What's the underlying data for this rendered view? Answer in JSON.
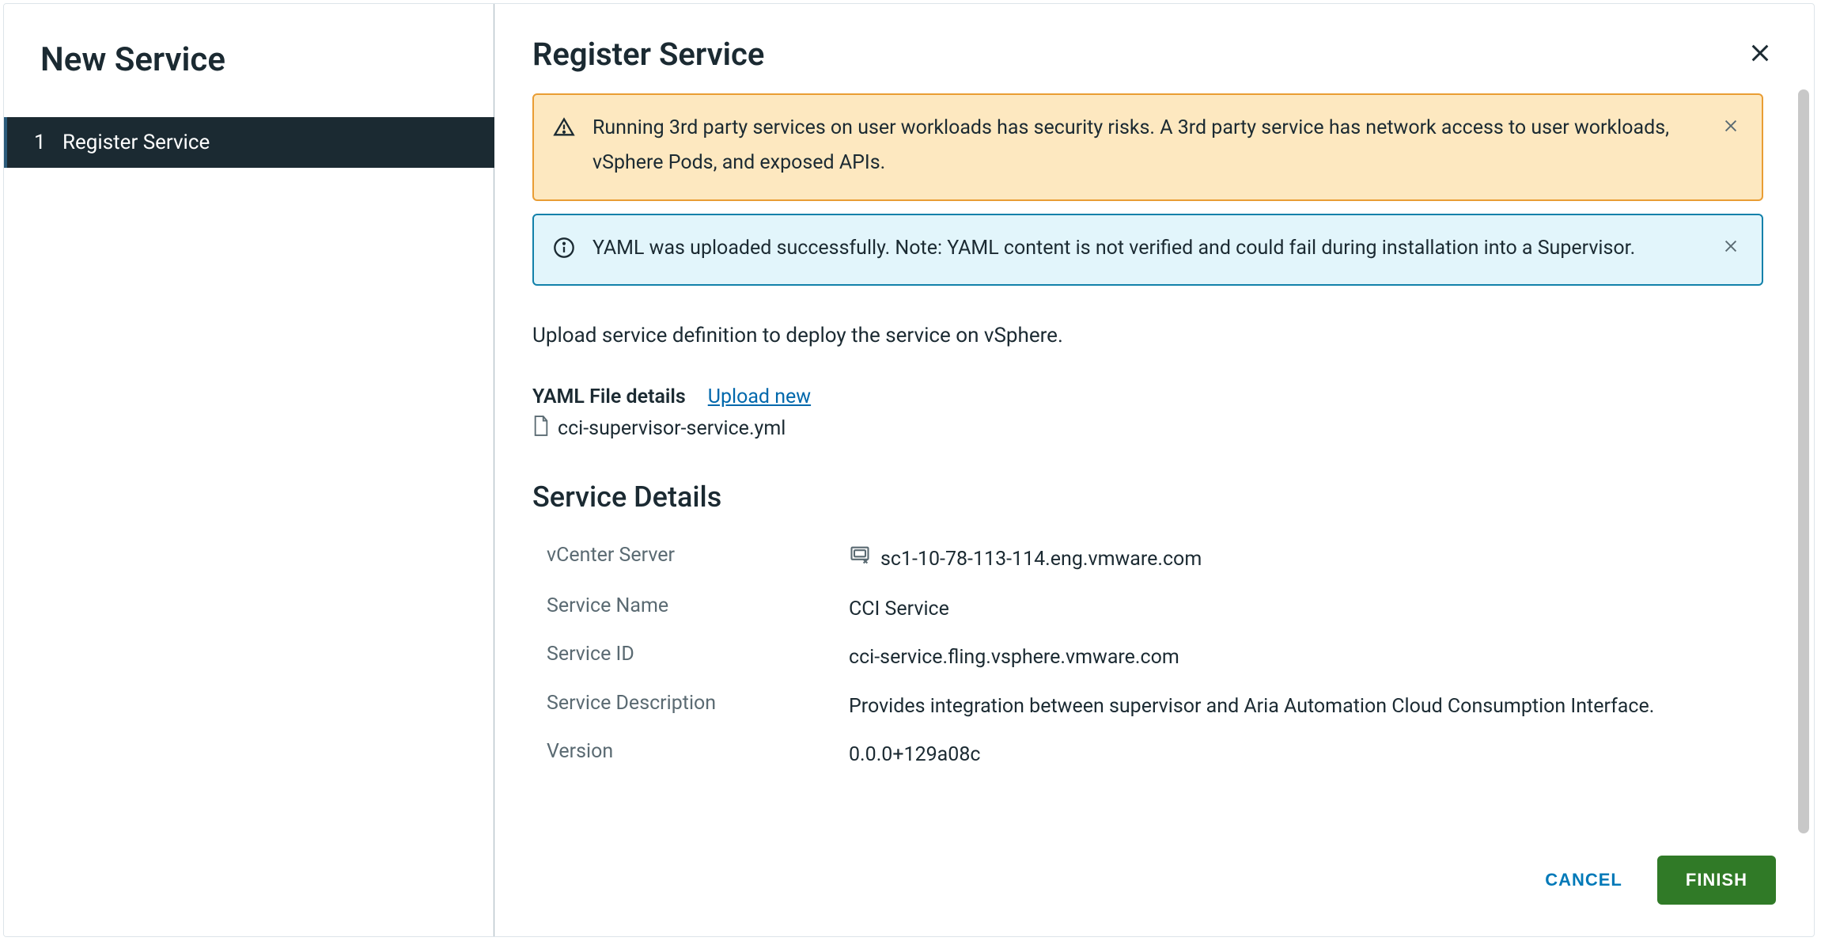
{
  "left": {
    "title": "New Service",
    "steps": [
      {
        "num": "1",
        "label": "Register Service"
      }
    ]
  },
  "right": {
    "title": "Register Service",
    "alerts": {
      "warning": "Running 3rd party services on user workloads has security risks. A 3rd party service has network access to user workloads, vSphere Pods, and exposed APIs.",
      "info": "YAML was uploaded successfully. Note: YAML content is not verified and could fail during installation into a Supervisor."
    },
    "upload_desc": "Upload service definition to deploy the service on vSphere.",
    "yaml_label": "YAML File details",
    "upload_new": "Upload new",
    "file_name": "cci-supervisor-service.yml",
    "section_heading": "Service Details",
    "details": {
      "vcenter_label": "vCenter Server",
      "vcenter_value": "sc1-10-78-113-114.eng.vmware.com",
      "name_label": "Service Name",
      "name_value": "CCI Service",
      "id_label": "Service ID",
      "id_value": "cci-service.fling.vsphere.vmware.com",
      "desc_label": "Service Description",
      "desc_value": "Provides integration between supervisor and Aria Automation Cloud Consumption Interface.",
      "version_label": "Version",
      "version_value": "0.0.0+129a08c"
    },
    "footer": {
      "cancel": "CANCEL",
      "finish": "FINISH"
    }
  }
}
